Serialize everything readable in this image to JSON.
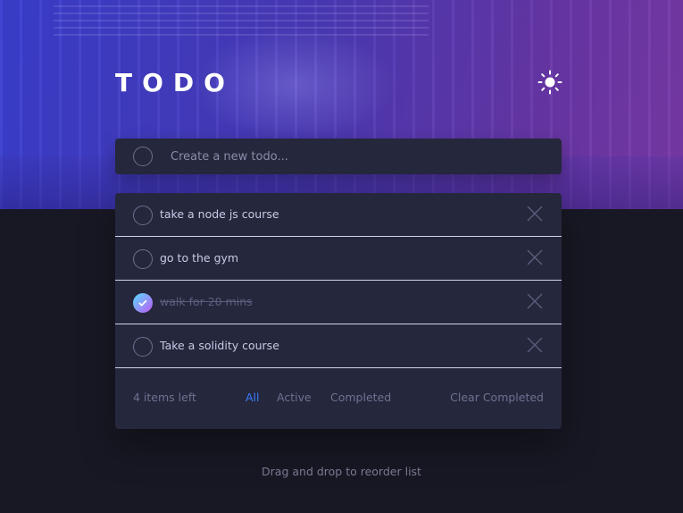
{
  "header": {
    "title": "TODO",
    "theme_icon": "sun-icon"
  },
  "new_todo": {
    "placeholder": "Create a new todo..."
  },
  "todos": [
    {
      "text": "take a node js course",
      "completed": false
    },
    {
      "text": "go to the gym",
      "completed": false
    },
    {
      "text": "walk for 20 mins",
      "completed": true
    },
    {
      "text": "Take a solidity course",
      "completed": false
    }
  ],
  "footer": {
    "items_left": "4 items left",
    "filters": [
      "All",
      "Active",
      "Completed"
    ],
    "active_filter": "All",
    "clear_label": "Clear Completed"
  },
  "hint": "Drag and drop to reorder list",
  "colors": {
    "accent": "#3a7cfd",
    "check_gradient_start": "#55ddff",
    "check_gradient_end": "#c058f3",
    "card_bg": "#25273c",
    "page_bg": "#181824"
  }
}
